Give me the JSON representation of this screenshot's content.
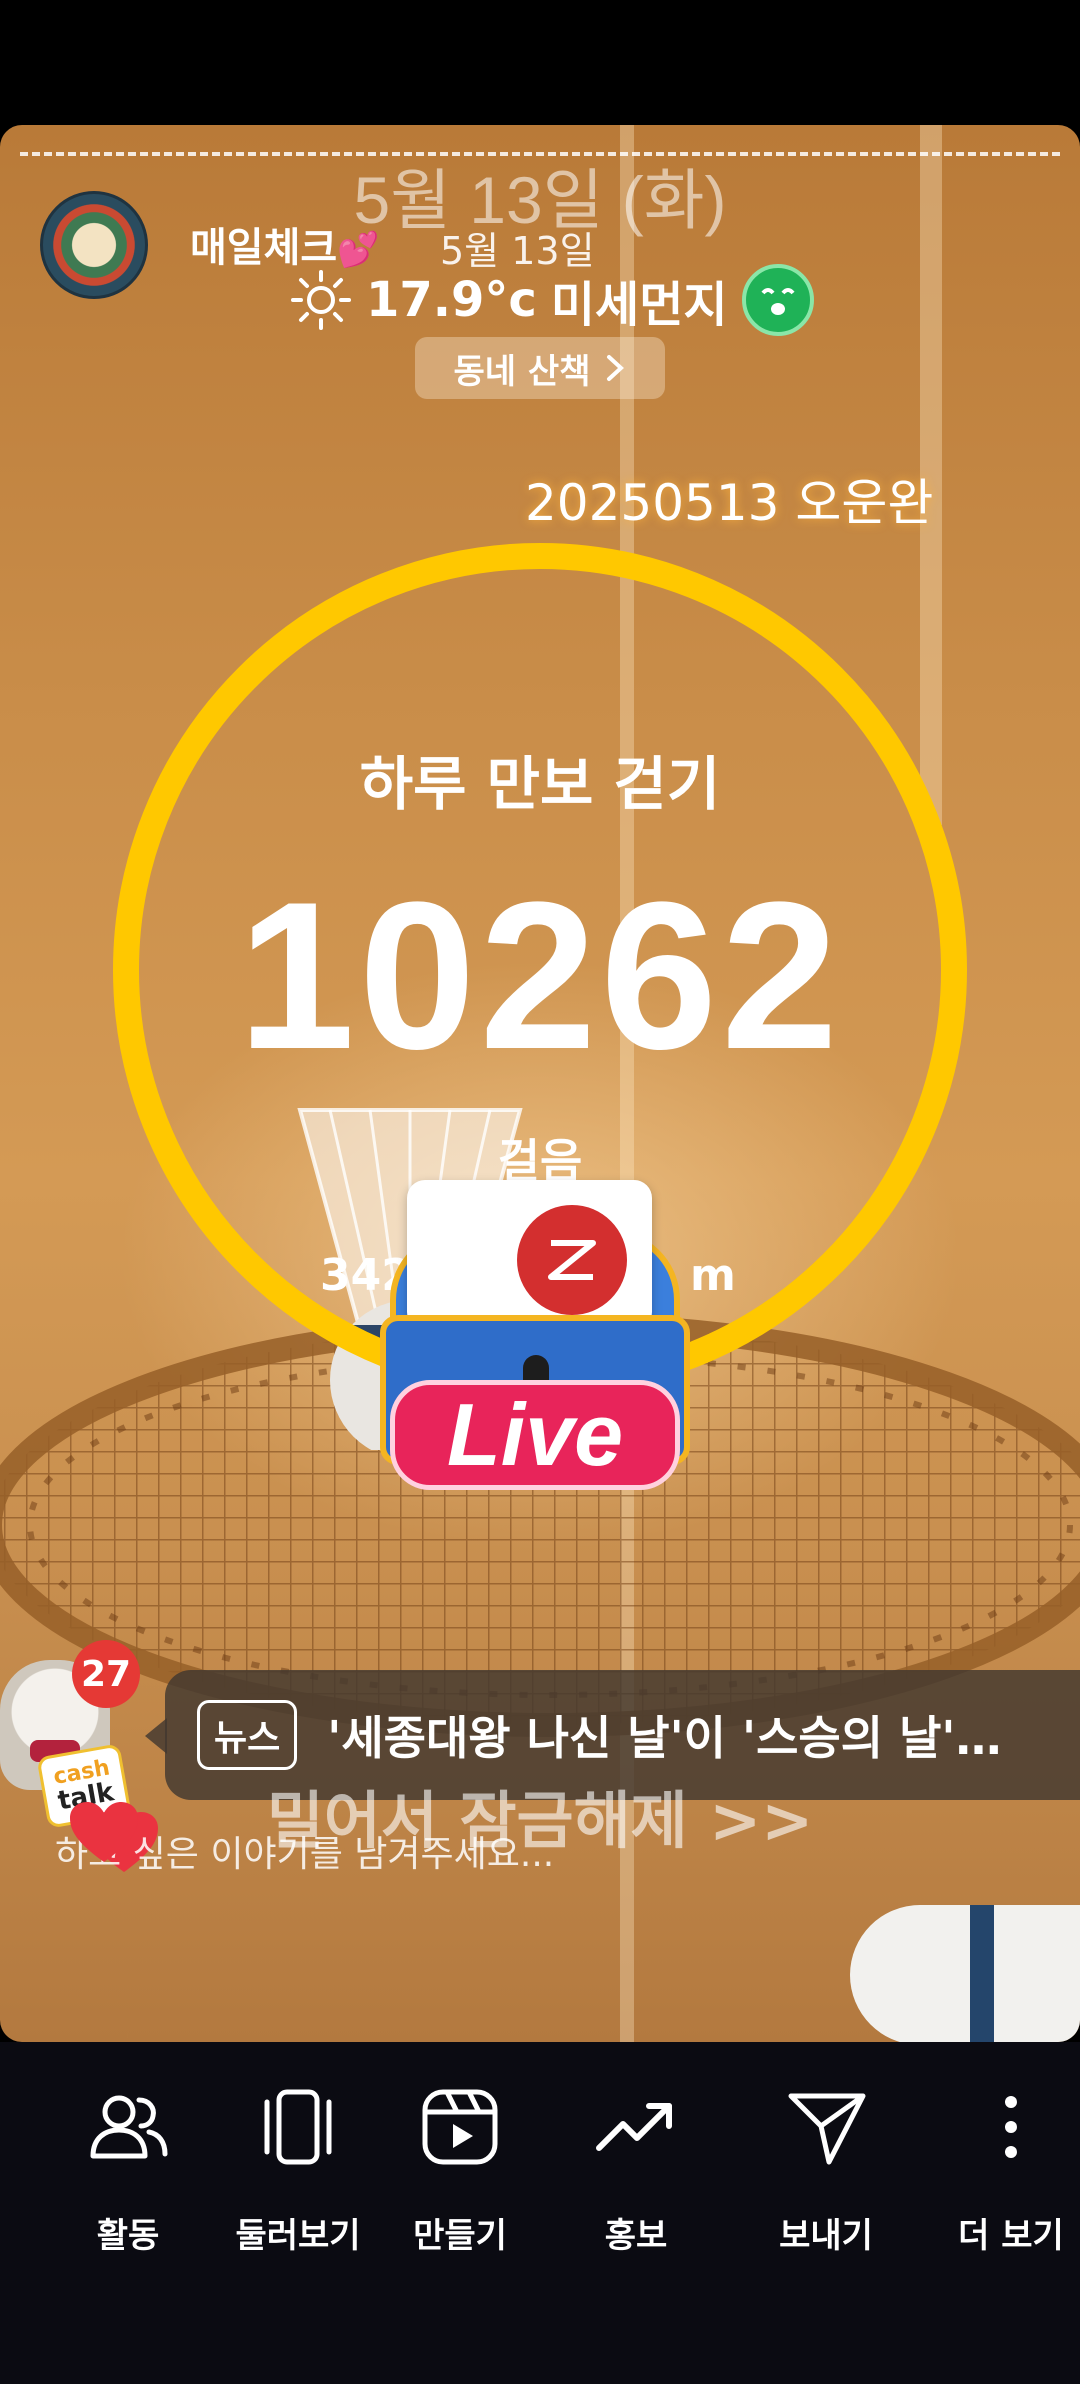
{
  "story": {
    "date_header": "5월 13일 (화)",
    "account_name": "매일체크",
    "account_emoji": "💕",
    "time": "5월 13일",
    "weather": {
      "temperature": "17.9°c",
      "air_label": "미세먼지",
      "sun_icon": "sun-icon",
      "air_icon": "good-face-icon",
      "air_color": "#1fb257"
    },
    "walk_chip": "동네 산책",
    "workout_label": "20250513 오운완",
    "goal_title": "하루 만보 걷기",
    "step_count": "10262",
    "step_unit": "걸음",
    "distance_value": "342",
    "distance_unit": "m",
    "ring_color": "#ffc800"
  },
  "live_sticker": {
    "label": "Live",
    "logo_icon": "zigzag-logo-icon"
  },
  "cashtalk": {
    "badge_count": "27",
    "logo_line1": "cash",
    "logo_line2": "talk"
  },
  "news": {
    "tag": "뉴스",
    "text": "'세종대왕 나신 날'이 '스승의 날'…"
  },
  "unlock_text": "밀어서 잠금해제 >>",
  "comment_placeholder": "하고 싶은 이야기를 남겨주세요...",
  "bottom_bar": {
    "items": [
      {
        "label": "활동",
        "icon": "people-icon"
      },
      {
        "label": "둘러보기",
        "icon": "swipe-icon"
      },
      {
        "label": "만들기",
        "icon": "reels-icon"
      },
      {
        "label": "홍보",
        "icon": "trend-up-icon"
      },
      {
        "label": "보내기",
        "icon": "send-icon"
      },
      {
        "label": "더 보기",
        "icon": "more-vertical-icon"
      }
    ]
  }
}
